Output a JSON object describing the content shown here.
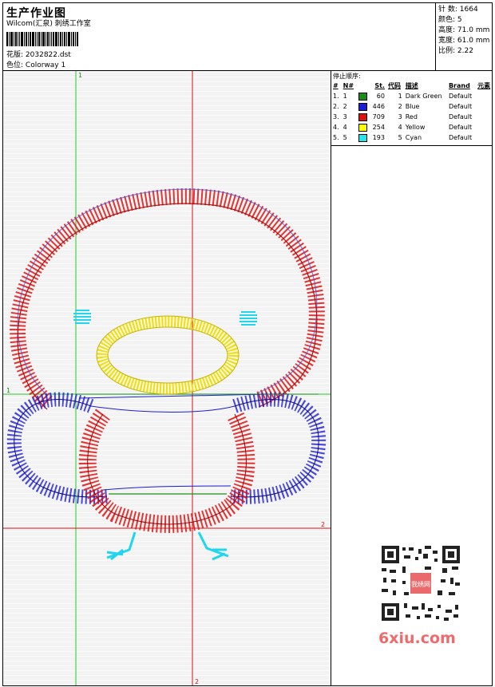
{
  "header": {
    "title": "生产作业图",
    "studio": "Wilcom(汇泉) 刺绣工作室",
    "design_label": "花版:",
    "design_value": "2032822.dst",
    "colorway_label": "色位:",
    "colorway_value": "Colorway 1"
  },
  "stats": [
    {
      "label": "针 数:",
      "value": "1664"
    },
    {
      "label": "颜色:",
      "value": "5"
    },
    {
      "label": "高度:",
      "value": "71.0 mm"
    },
    {
      "label": "宽度:",
      "value": "61.0 mm"
    },
    {
      "label": "比例:",
      "value": "2.22"
    }
  ],
  "guides": {
    "v1": "1",
    "h1": "1",
    "v2": "2",
    "h2": "2"
  },
  "stop_sequence": {
    "title": "停止顺序:",
    "headers": [
      "#",
      "N#",
      "St.",
      "代码",
      "描述",
      "Brand",
      "元素"
    ],
    "rows": [
      {
        "idx": "1.",
        "n": "1",
        "color": "#1a8c1a",
        "st": "60",
        "code": "1",
        "desc": "Dark Green",
        "brand": "Default"
      },
      {
        "idx": "2.",
        "n": "2",
        "color": "#1d1dd6",
        "st": "446",
        "code": "2",
        "desc": "Blue",
        "brand": "Default"
      },
      {
        "idx": "3.",
        "n": "3",
        "color": "#e01010",
        "st": "709",
        "code": "3",
        "desc": "Red",
        "brand": "Default"
      },
      {
        "idx": "4.",
        "n": "4",
        "color": "#ffff00",
        "st": "254",
        "code": "4",
        "desc": "Yellow",
        "brand": "Default"
      },
      {
        "idx": "5.",
        "n": "5",
        "color": "#22e5ee",
        "st": "193",
        "code": "5",
        "desc": "Cyan",
        "brand": "Default"
      }
    ]
  },
  "watermark": {
    "logo_text": "6xiu.com",
    "qr_stamp": "我绣网"
  }
}
